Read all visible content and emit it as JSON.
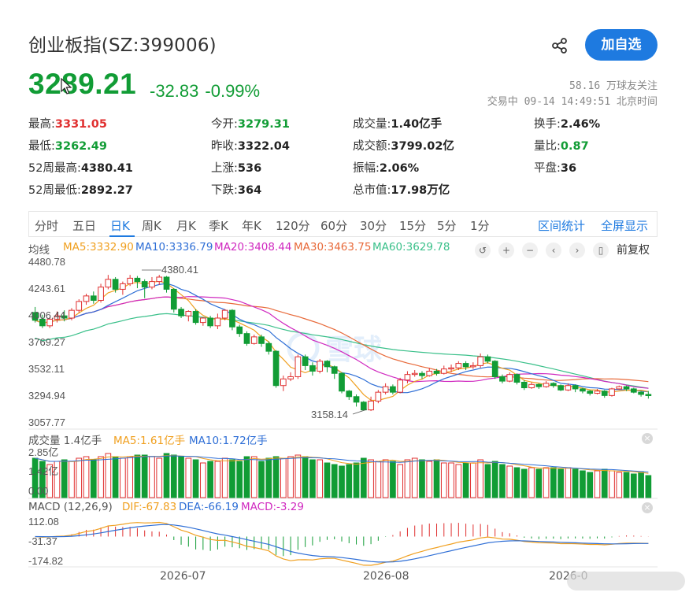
{
  "header": {
    "title": "创业板指(SZ:399006)",
    "follow_label": "加自选",
    "price": "3289.21",
    "change_abs": "-32.83",
    "change_pct": "-0.99%",
    "followers": "58.16 万球友关注",
    "trade_status": "交易中 09-14 14:49:51 北京时间"
  },
  "stats": [
    {
      "label": "最高:",
      "value": "3331.05",
      "color": "red"
    },
    {
      "label": "今开:",
      "value": "3279.31",
      "color": "green"
    },
    {
      "label": "成交量:",
      "value": "1.40亿手",
      "color": "dark"
    },
    {
      "label": "换手:",
      "value": "2.46%",
      "color": "dark"
    },
    {
      "label": "最低:",
      "value": "3262.49",
      "color": "green"
    },
    {
      "label": "昨收:",
      "value": "3322.04",
      "color": "dark"
    },
    {
      "label": "成交额:",
      "value": "3799.02亿",
      "color": "dark"
    },
    {
      "label": "量比:",
      "value": "0.87",
      "color": "green"
    },
    {
      "label": "52周最高:",
      "value": "4380.41",
      "color": "dark"
    },
    {
      "label": "上涨:",
      "value": "536",
      "color": "dark"
    },
    {
      "label": "振幅:",
      "value": "2.06%",
      "color": "dark"
    },
    {
      "label": "平盘:",
      "value": "36",
      "color": "dark"
    },
    {
      "label": "52周最低:",
      "value": "2892.27",
      "color": "dark"
    },
    {
      "label": "下跌:",
      "value": "364",
      "color": "dark"
    },
    {
      "label": "总市值:",
      "value": "17.98万亿",
      "color": "dark"
    }
  ],
  "tabs": [
    "分时",
    "五日",
    "日K",
    "周K",
    "月K",
    "季K",
    "年K",
    "120分",
    "60分",
    "30分",
    "15分",
    "5分",
    "1分"
  ],
  "active_tab": "日K",
  "tab_actions": [
    "区间统计",
    "全屏显示"
  ],
  "ma_legend": {
    "label": "均线",
    "ma5": "MA5:3332.90",
    "ma10": "MA10:3336.79",
    "ma20": "MA20:3408.44",
    "ma30": "MA30:3463.75",
    "ma60": "MA60:3629.78"
  },
  "adjust_label": "前复权",
  "colors": {
    "up": "#e03030",
    "down": "#119c35",
    "ma5": "#f0a020",
    "ma10": "#2f6fd6",
    "ma20": "#d02ac0",
    "ma30": "#e86a3a",
    "ma60": "#3ac08a",
    "accent": "#1e7ae0"
  },
  "chart_data": [
    {
      "type": "candlestick",
      "title": "",
      "y_ticks": [
        "4480.78",
        "4243.61",
        "4006.44",
        "3769.27",
        "3532.11",
        "3294.94",
        "3057.77"
      ],
      "ylim": [
        3057.77,
        4480.78
      ],
      "annotations": [
        {
          "text": "4380.41"
        },
        {
          "text": "3158.14"
        }
      ],
      "x_ticks": [
        "2026-07",
        "2026-08",
        "2026-0"
      ],
      "ohlc": [
        [
          4040,
          3970,
          4090,
          3950
        ],
        [
          3980,
          3920,
          4020,
          3900
        ],
        [
          3920,
          3980,
          4000,
          3900
        ],
        [
          3980,
          4010,
          4050,
          3950
        ],
        [
          4010,
          3990,
          4060,
          3960
        ],
        [
          3990,
          4060,
          4080,
          3970
        ],
        [
          4060,
          4140,
          4160,
          4040
        ],
        [
          4140,
          4190,
          4210,
          4110
        ],
        [
          4190,
          4150,
          4230,
          4120
        ],
        [
          4150,
          4270,
          4300,
          4130
        ],
        [
          4270,
          4340,
          4380,
          4250
        ],
        [
          4340,
          4250,
          4360,
          4220
        ],
        [
          4250,
          4300,
          4320,
          4200
        ],
        [
          4300,
          4350,
          4380,
          4280
        ],
        [
          4350,
          4320,
          4370,
          4260
        ],
        [
          4320,
          4270,
          4340,
          4170
        ],
        [
          4270,
          4320,
          4360,
          4250
        ],
        [
          4320,
          4360,
          4380,
          4290
        ],
        [
          4360,
          4250,
          4370,
          4220
        ],
        [
          4250,
          4070,
          4260,
          4040
        ],
        [
          4070,
          4010,
          4090,
          3990
        ],
        [
          4010,
          4050,
          4060,
          3960
        ],
        [
          4050,
          3950,
          4070,
          3930
        ],
        [
          3950,
          3990,
          4000,
          3920
        ],
        [
          3990,
          3920,
          4010,
          3900
        ],
        [
          3920,
          3990,
          4030,
          3890
        ],
        [
          3990,
          4060,
          4070,
          3970
        ],
        [
          4060,
          3910,
          4070,
          3880
        ],
        [
          3910,
          3850,
          3930,
          3820
        ],
        [
          3850,
          3760,
          3870,
          3740
        ],
        [
          3760,
          3820,
          3840,
          3750
        ],
        [
          3820,
          3760,
          3840,
          3730
        ],
        [
          3760,
          3690,
          3780,
          3660
        ],
        [
          3690,
          3380,
          3700,
          3360
        ],
        [
          3380,
          3440,
          3470,
          3330
        ],
        [
          3440,
          3460,
          3500,
          3420
        ],
        [
          3460,
          3640,
          3660,
          3440
        ],
        [
          3640,
          3560,
          3660,
          3520
        ],
        [
          3560,
          3510,
          3590,
          3470
        ],
        [
          3510,
          3600,
          3620,
          3490
        ],
        [
          3600,
          3550,
          3610,
          3500
        ],
        [
          3550,
          3490,
          3560,
          3440
        ],
        [
          3490,
          3330,
          3500,
          3310
        ],
        [
          3330,
          3280,
          3340,
          3250
        ],
        [
          3280,
          3230,
          3300,
          3190
        ],
        [
          3230,
          3160,
          3240,
          3158
        ],
        [
          3160,
          3240,
          3280,
          3150
        ],
        [
          3240,
          3320,
          3340,
          3220
        ],
        [
          3320,
          3370,
          3400,
          3300
        ],
        [
          3370,
          3320,
          3390,
          3300
        ],
        [
          3320,
          3430,
          3450,
          3310
        ],
        [
          3430,
          3480,
          3510,
          3400
        ],
        [
          3480,
          3490,
          3520,
          3460
        ],
        [
          3490,
          3470,
          3510,
          3440
        ],
        [
          3470,
          3510,
          3540,
          3460
        ],
        [
          3510,
          3490,
          3530,
          3470
        ],
        [
          3490,
          3530,
          3560,
          3480
        ],
        [
          3530,
          3540,
          3570,
          3500
        ],
        [
          3540,
          3580,
          3600,
          3520
        ],
        [
          3580,
          3550,
          3600,
          3520
        ],
        [
          3550,
          3560,
          3590,
          3530
        ],
        [
          3560,
          3640,
          3670,
          3540
        ],
        [
          3640,
          3600,
          3660,
          3580
        ],
        [
          3600,
          3460,
          3610,
          3440
        ],
        [
          3460,
          3420,
          3480,
          3400
        ],
        [
          3420,
          3480,
          3500,
          3410
        ],
        [
          3480,
          3410,
          3490,
          3390
        ],
        [
          3410,
          3360,
          3430,
          3340
        ],
        [
          3360,
          3390,
          3410,
          3350
        ],
        [
          3390,
          3370,
          3400,
          3350
        ],
        [
          3370,
          3400,
          3420,
          3360
        ],
        [
          3400,
          3380,
          3410,
          3360
        ],
        [
          3380,
          3340,
          3390,
          3330
        ],
        [
          3340,
          3380,
          3400,
          3330
        ],
        [
          3380,
          3350,
          3390,
          3320
        ],
        [
          3350,
          3330,
          3360,
          3310
        ],
        [
          3330,
          3310,
          3340,
          3290
        ],
        [
          3310,
          3330,
          3350,
          3300
        ],
        [
          3330,
          3290,
          3340,
          3270
        ],
        [
          3290,
          3350,
          3360,
          3280
        ],
        [
          3350,
          3370,
          3380,
          3340
        ],
        [
          3370,
          3350,
          3380,
          3330
        ],
        [
          3350,
          3320,
          3360,
          3310
        ],
        [
          3320,
          3300,
          3330,
          3280
        ],
        [
          3300,
          3289,
          3331,
          3262
        ]
      ]
    },
    {
      "type": "bar",
      "title": "成交量",
      "legend": {
        "label": "成交量 1.4亿手",
        "ma5": "MA5:1.61亿手",
        "ma10": "MA10:1.72亿手"
      },
      "y_ticks": [
        "2.85亿",
        "1.42亿",
        "0.00"
      ],
      "values": [
        2.5,
        2.3,
        2.1,
        2.3,
        2.4,
        2.3,
        2.5,
        2.6,
        2.4,
        2.6,
        2.8,
        2.6,
        2.5,
        2.6,
        2.7,
        2.7,
        2.6,
        2.5,
        2.8,
        2.7,
        2.6,
        2.5,
        2.4,
        2.2,
        2.3,
        2.3,
        2.5,
        2.4,
        2.3,
        2.6,
        2.6,
        2.3,
        2.5,
        2.6,
        2.5,
        2.6,
        2.7,
        2.6,
        2.4,
        2.4,
        2.2,
        2.1,
        2.0,
        2.1,
        2.2,
        2.5,
        2.4,
        2.3,
        2.4,
        2.3,
        2.1,
        2.4,
        2.5,
        2.4,
        2.3,
        2.4,
        2.2,
        2.2,
        2.1,
        2.2,
        2.2,
        2.4,
        2.1,
        2.3,
        2.1,
        2.0,
        1.9,
        1.8,
        1.9,
        1.8,
        1.9,
        1.9,
        1.8,
        1.9,
        1.8,
        1.7,
        1.6,
        1.7,
        1.8,
        1.7,
        1.6,
        1.6,
        1.5,
        1.6,
        1.4
      ]
    },
    {
      "type": "bar",
      "title": "MACD",
      "legend": {
        "label": "MACD (12,26,9)",
        "dif": "DIF:-67.83",
        "dea": "DEA:-66.19",
        "macd": "MACD:-3.29"
      },
      "y_ticks": [
        "112.08",
        "-31.37",
        "-174.82"
      ]
    }
  ]
}
